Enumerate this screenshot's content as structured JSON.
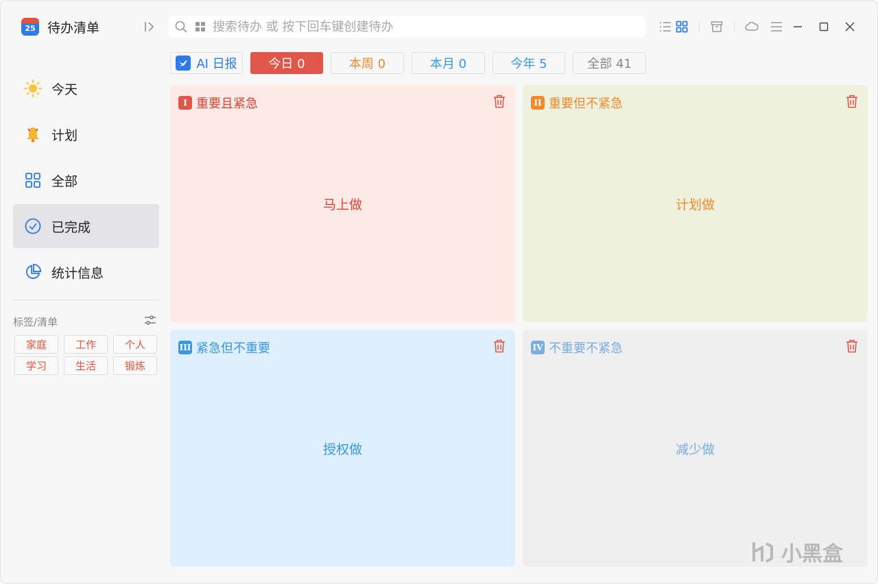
{
  "app": {
    "title": "待办清单",
    "logo_number": "25"
  },
  "search": {
    "placeholder": "搜索待办 或 按下回车键创建待办",
    "value": ""
  },
  "sidebar": {
    "items": [
      {
        "label": "今天",
        "icon": "sun-icon"
      },
      {
        "label": "计划",
        "icon": "bell-icon"
      },
      {
        "label": "全部",
        "icon": "grid-icon"
      },
      {
        "label": "已完成",
        "icon": "check-circle-icon",
        "active": true
      },
      {
        "label": "统计信息",
        "icon": "pie-chart-icon"
      }
    ],
    "tags_header": "标签/清单",
    "tags": [
      "家庭",
      "工作",
      "个人",
      "学习",
      "生活",
      "锻炼"
    ]
  },
  "filters": {
    "ai_report": "AI 日报",
    "today": "今日 0",
    "week": "本周 0",
    "month": "本月 0",
    "year": "今年 5",
    "all": "全部 41"
  },
  "quadrants": [
    {
      "roman": "I",
      "title": "重要且紧急",
      "center": "马上做",
      "color": "#e0574a"
    },
    {
      "roman": "II",
      "title": "重要但不紧急",
      "center": "计划做",
      "color": "#ef8a2e"
    },
    {
      "roman": "III",
      "title": "紧急但不重要",
      "center": "授权做",
      "color": "#3a97e4"
    },
    {
      "roman": "IV",
      "title": "不重要不紧急",
      "center": "减少做",
      "color": "#7aace0"
    }
  ],
  "colors": {
    "accent": "#2f7ae5",
    "danger": "#e0574a"
  },
  "watermark": "小黑盒"
}
